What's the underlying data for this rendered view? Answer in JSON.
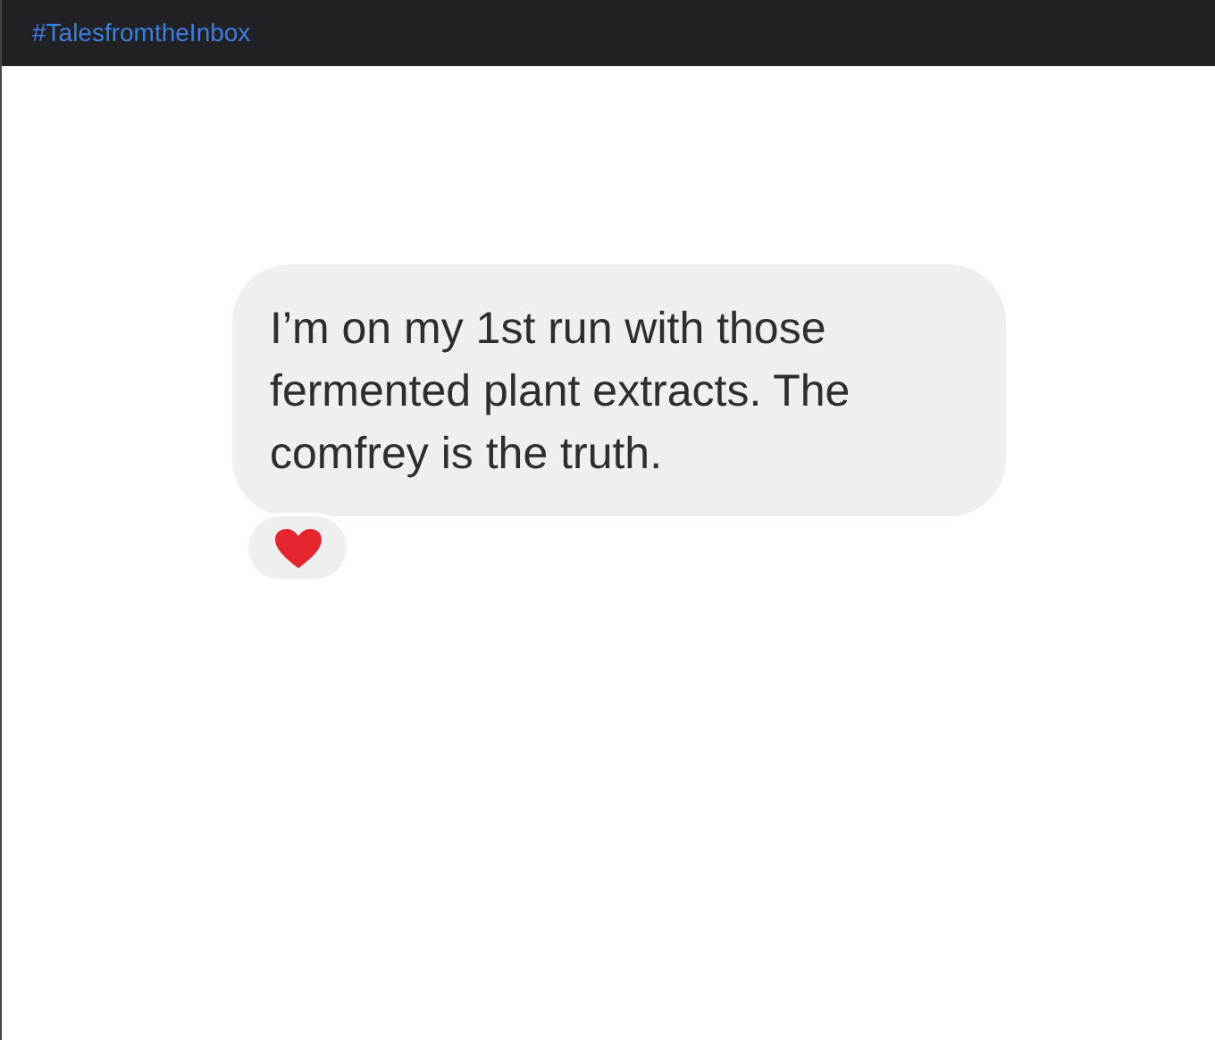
{
  "header": {
    "title": "#TalesfromtheInbox"
  },
  "message": {
    "text": "I’m on my 1st run with those fermented plant extracts. The comfrey is the truth.",
    "reaction": {
      "kind": "heart"
    }
  }
}
